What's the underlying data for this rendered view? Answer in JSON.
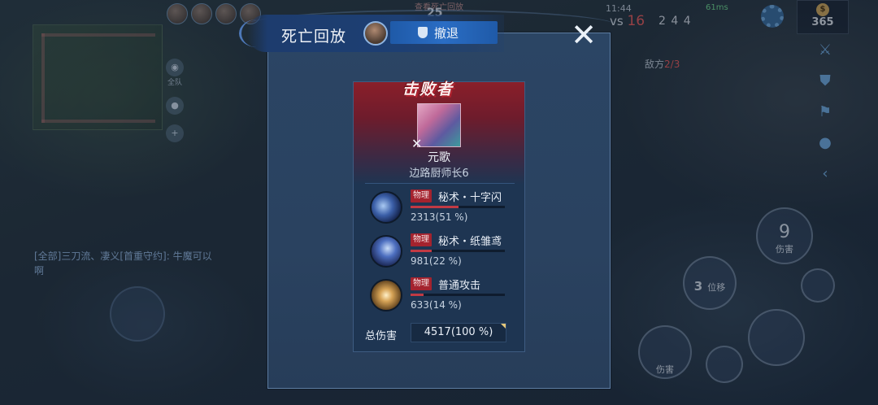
{
  "hud": {
    "top_center_text": "查看死亡回放",
    "top_center_number": "25",
    "time": "11:44",
    "kills_prefix": "vs",
    "kills_enemy": "16",
    "signal": "61ms",
    "kda": "2  4  4",
    "gold": "365",
    "enemy_label": "敌方",
    "enemy_count": "2/3",
    "chat_line": "[全部]三刀流、凄义[首重守约]: 牛魔可以啊",
    "left_icon_label": "全队",
    "skill_right_big": "9",
    "skill_right_label": "伤害",
    "skill_mid_num": "3",
    "skill_mid_label": "位移",
    "skill_bottom_label": "伤害"
  },
  "dialog": {
    "title": "死亡回放",
    "retreat_label": "撤退",
    "close_symbol": "✕",
    "defeated_label": "击败者",
    "hero_name": "元歌",
    "player_name": "边路厨师长6",
    "skills": [
      {
        "icon": "cross-slash-skill-icon",
        "tag": "物理",
        "name": "秘术・十字闪",
        "damage": "2313(51 %)",
        "percent": 51
      },
      {
        "icon": "paper-bird-skill-icon",
        "tag": "物理",
        "name": "秘术・纸雏鸢",
        "damage": "981(22 %)",
        "percent": 22
      },
      {
        "icon": "basic-attack-skill-icon",
        "tag": "物理",
        "name": "普通攻击",
        "damage": "633(14 %)",
        "percent": 14
      }
    ],
    "total_label": "总伤害",
    "total_value": "4517(100 %)"
  },
  "colors": {
    "panel": "#2a4260",
    "accent_red": "#a4232e",
    "retreat_blue": "#2a6dc4"
  }
}
